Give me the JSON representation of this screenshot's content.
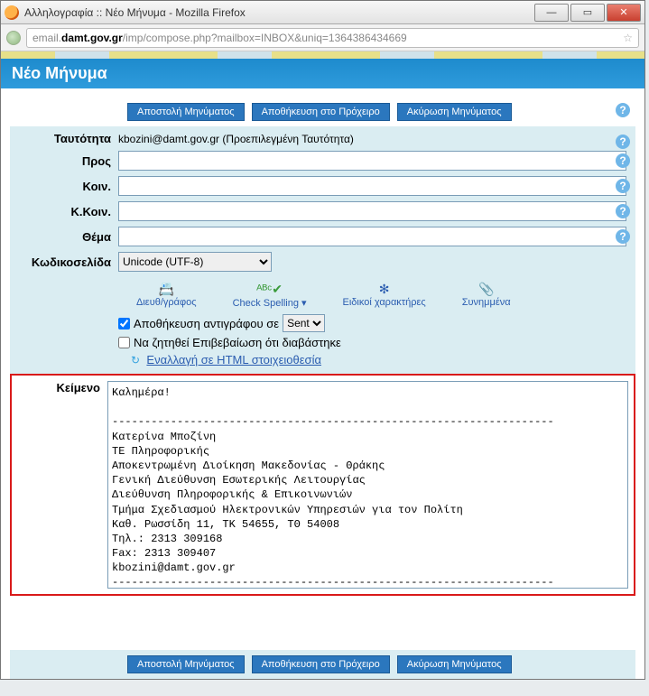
{
  "window": {
    "title": "Αλληλογραφία :: Νέο Μήνυμα - Mozilla Firefox",
    "url_host": "damt.gov.gr",
    "url_prefix": "email.",
    "url_path": "/imp/compose.php?mailbox=INBOX&uniq=1364386434669"
  },
  "page": {
    "header": "Νέο Μήνυμα"
  },
  "buttons": {
    "send": "Αποστολή Μηνύματος",
    "save": "Αποθήκευση στο Πρόχειρο",
    "cancel": "Ακύρωση Μηνύματος"
  },
  "labels": {
    "identity": "Ταυτότητα",
    "to": "Προς",
    "cc": "Κοιν.",
    "bcc": "Κ.Κοιν.",
    "subject": "Θέμα",
    "encoding": "Κωδικοσελίδα",
    "body": "Κείμενο"
  },
  "identity_value": "kbozini@damt.gov.gr (Προεπιλεγμένη Ταυτότητα)",
  "fields": {
    "to": "",
    "cc": "",
    "bcc": "",
    "subject": ""
  },
  "encoding_value": "Unicode (UTF-8)",
  "tools": {
    "addrbook": "Διευθ/γράφος",
    "spell": "Check Spelling",
    "special": "Ειδικοί χαρακτήρες",
    "attach": "Συνημμένα"
  },
  "options": {
    "save_copy": "Αποθήκευση αντιγράφου σε",
    "sent_folder": "Sent",
    "read_receipt": "Να ζητηθεί Επιβεβαίωση ότι διαβάστηκε"
  },
  "html_toggle": "Εναλλαγή σε HTML στοιχειοθεσία",
  "body_text": "Καλημέρα!\n\n--------------------------------------------------------------------\nΚατερίνα Μποζίνη\nΤΕ Πληροφορικής\nΑποκεντρωμένη Διοίκηση Μακεδονίας - Θράκης\nΓενική Διεύθυνση Εσωτερικής Λειτουργίας\nΔιεύθυνση Πληροφορικής & Επικοινωνιών\nΤμήμα Σχεδιασμού Ηλεκτρονικών Υπηρεσιών για τον Πολίτη\nΚαθ. Ρωσσίδη 11, ΤΚ 54655, ΤΘ 54008\nΤηλ.: 2313 309168\nFax: 2313 309407\nkbozini@damt.gov.gr\n--------------------------------------------------------------------"
}
